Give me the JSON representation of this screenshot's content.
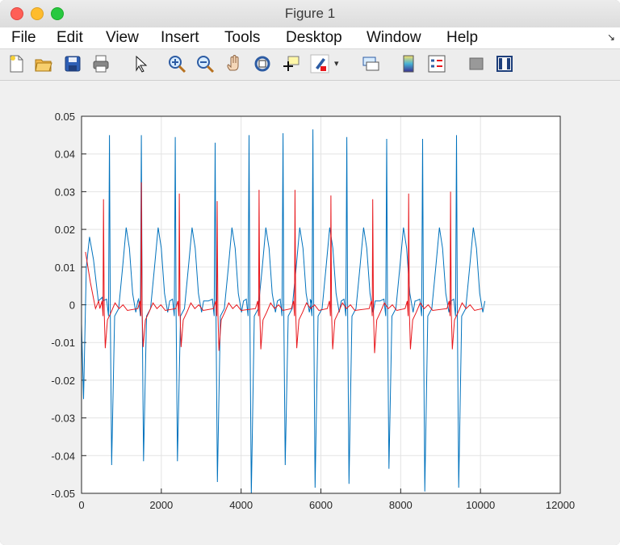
{
  "window": {
    "title": "Figure 1"
  },
  "menubar": {
    "items": [
      "File",
      "Edit",
      "View",
      "Insert",
      "Tools",
      "Desktop",
      "Window",
      "Help"
    ],
    "overflow_icon": "dock-arrow-icon"
  },
  "toolbar": {
    "buttons": [
      "new-figure-icon",
      "open-file-icon",
      "save-icon",
      "print-icon",
      "pointer-icon",
      "zoom-in-icon",
      "zoom-out-icon",
      "pan-icon",
      "rotate-3d-icon",
      "data-cursor-icon",
      "brush-icon",
      "brush-menu-icon",
      "link-plot-icon",
      "colorbar-icon",
      "legend-icon",
      "hide-plot-tools-icon",
      "show-plot-tools-icon"
    ]
  },
  "colors": {
    "series_blue": "#0072bd",
    "series_red": "#e8161b",
    "grid": "#e3e3e3",
    "axes": "#262626"
  },
  "chart_data": {
    "type": "line",
    "title": "",
    "xlabel": "",
    "ylabel": "",
    "xlim": [
      0,
      12000
    ],
    "ylim": [
      -0.05,
      0.05
    ],
    "x_ticks": [
      "0",
      "2000",
      "4000",
      "6000",
      "8000",
      "10000",
      "12000"
    ],
    "y_ticks": [
      "0.05",
      "0.04",
      "0.03",
      "0.02",
      "0.01",
      "0",
      "-0.01",
      "-0.02",
      "-0.03",
      "-0.04",
      "-0.05"
    ],
    "grid": true,
    "series": [
      {
        "color": "#0072bd",
        "start_point": [
          0,
          -0.005
        ],
        "initial_dip": [
          50,
          -0.025
        ],
        "initial_bump": [
          200,
          0.018
        ],
        "beat_peaks_x": [
          700,
          1500,
          2350,
          3350,
          4200,
          5050,
          5800,
          6650,
          7650,
          8550,
          9400
        ],
        "beat_peaks_y": [
          0.045,
          0.045,
          0.0445,
          0.043,
          0.045,
          0.0455,
          0.0465,
          0.0445,
          0.044,
          0.044,
          0.045
        ],
        "beat_troughs_y": [
          -0.0425,
          -0.0415,
          -0.0415,
          -0.047,
          -0.0505,
          -0.0425,
          -0.0485,
          -0.0475,
          -0.0435,
          -0.0495,
          -0.0485
        ],
        "t_wave_y": [
          0.0205,
          0.0205,
          0.0205,
          0.0205,
          0.0205,
          0.0205,
          0.0205,
          0.0205,
          0.0205,
          0.0205,
          0.0205
        ],
        "end_x": 10000,
        "end_y": -0.002
      },
      {
        "color": "#e8161b",
        "start_point": [
          100,
          0.014
        ],
        "beat_peaks_x": [
          550,
          1500,
          2450,
          3400,
          4450,
          5350,
          6250,
          7300,
          8200,
          9250
        ],
        "beat_peaks_y": [
          0.028,
          0.0325,
          0.0295,
          0.0275,
          0.0305,
          0.0305,
          0.029,
          0.028,
          0.0295,
          0.03
        ],
        "beat_troughs_y": [
          -0.0115,
          -0.0112,
          -0.0112,
          -0.0122,
          -0.0118,
          -0.0115,
          -0.0118,
          -0.0128,
          -0.0118,
          -0.0118
        ],
        "end_x": 10050,
        "end_y": -0.001
      }
    ]
  }
}
